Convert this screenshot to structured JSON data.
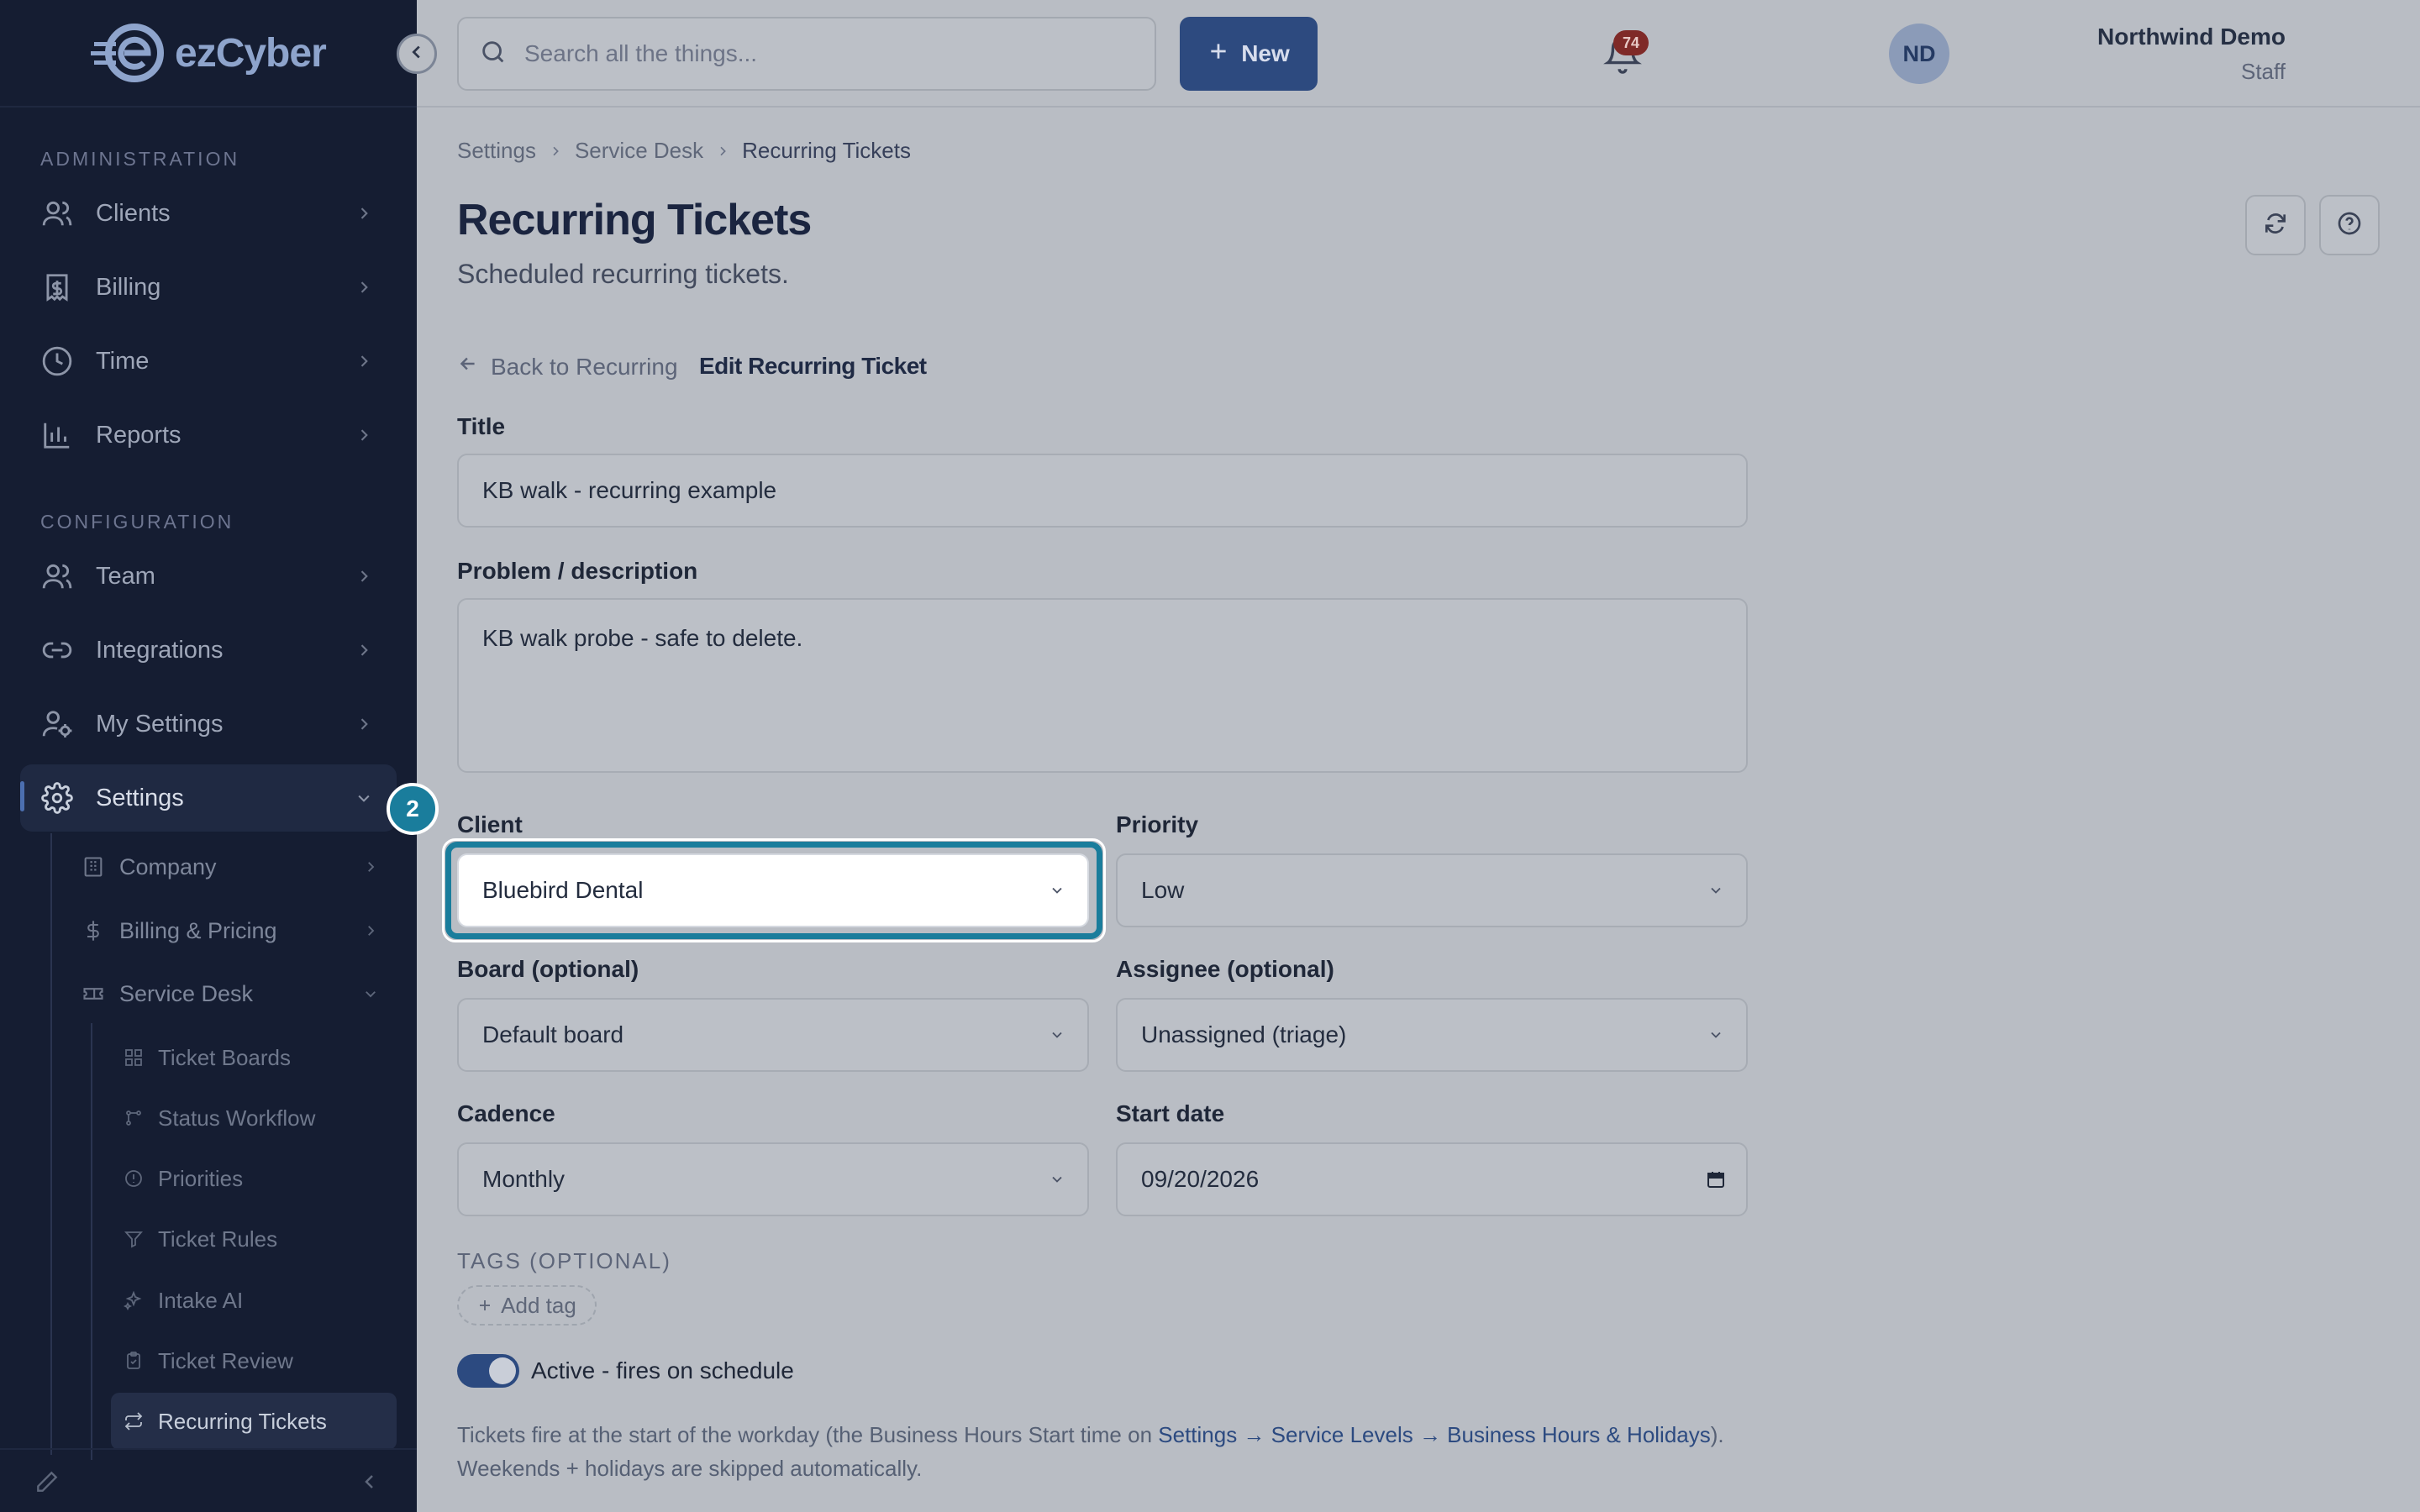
{
  "app": {
    "logo_text": "ezCyber"
  },
  "sidebar": {
    "admin_label": "ADMINISTRATION",
    "config_label": "CONFIGURATION",
    "admin_items": [
      {
        "label": "Clients",
        "icon": "users-icon"
      },
      {
        "label": "Billing",
        "icon": "receipt-icon"
      },
      {
        "label": "Time",
        "icon": "clock-icon"
      },
      {
        "label": "Reports",
        "icon": "bar-chart-icon"
      }
    ],
    "config_items": [
      {
        "label": "Team",
        "icon": "users-icon"
      },
      {
        "label": "Integrations",
        "icon": "link-icon"
      },
      {
        "label": "My Settings",
        "icon": "user-cog-icon"
      },
      {
        "label": "Settings",
        "icon": "gear-icon",
        "active": true
      }
    ],
    "settings_children": [
      {
        "label": "Company",
        "icon": "building-icon"
      },
      {
        "label": "Billing & Pricing",
        "icon": "dollar-icon"
      },
      {
        "label": "Service Desk",
        "icon": "ticket-icon",
        "expanded": true
      }
    ],
    "service_desk_children": [
      {
        "label": "Ticket Boards",
        "icon": "grid-icon"
      },
      {
        "label": "Status Workflow",
        "icon": "workflow-icon"
      },
      {
        "label": "Priorities",
        "icon": "alert-circle-icon"
      },
      {
        "label": "Ticket Rules",
        "icon": "filter-icon"
      },
      {
        "label": "Intake AI",
        "icon": "sparkles-icon"
      },
      {
        "label": "Ticket Review",
        "icon": "clipboard-icon"
      },
      {
        "label": "Recurring Tickets",
        "icon": "repeat-icon",
        "active": true
      }
    ]
  },
  "header": {
    "search_placeholder": "Search all the things...",
    "new_label": "New",
    "notification_count": "74",
    "user_name": "Northwind Demo",
    "user_role": "Staff",
    "avatar_initials": "ND"
  },
  "breadcrumb": [
    "Settings",
    "Service Desk",
    "Recurring Tickets"
  ],
  "page": {
    "title": "Recurring Tickets",
    "subtitle": "Scheduled recurring tickets.",
    "back_label": "Back to Recurring",
    "edit_label": "Edit Recurring Ticket"
  },
  "form": {
    "title_label": "Title",
    "title_value": "KB walk - recurring example",
    "description_label": "Problem / description",
    "description_value": "KB walk probe - safe to delete.",
    "client_label": "Client",
    "client_value": "Bluebird Dental",
    "priority_label": "Priority",
    "priority_value": "Low",
    "board_label": "Board (optional)",
    "board_value": "Default board",
    "assignee_label": "Assignee (optional)",
    "assignee_value": "Unassigned (triage)",
    "cadence_label": "Cadence",
    "cadence_value": "Monthly",
    "start_date_label": "Start date",
    "start_date_value": "09/20/2026",
    "tags_label": "TAGS (OPTIONAL)",
    "add_tag_label": "Add tag",
    "active_label": "Active - fires on schedule",
    "active_on": true
  },
  "note": {
    "prefix": "Tickets fire at the start of the workday (the Business Hours Start time on ",
    "link": "Settings → Service Levels → Business Hours & Holidays",
    "suffix": ").",
    "line2": "Weekends + holidays are skipped automatically."
  },
  "walkthrough": {
    "step": "2"
  },
  "colors": {
    "sidebar_bg": "#151d32",
    "accent": "#2d4a7f",
    "focus": "#1a7d9c",
    "badge": "#7f2a28"
  }
}
